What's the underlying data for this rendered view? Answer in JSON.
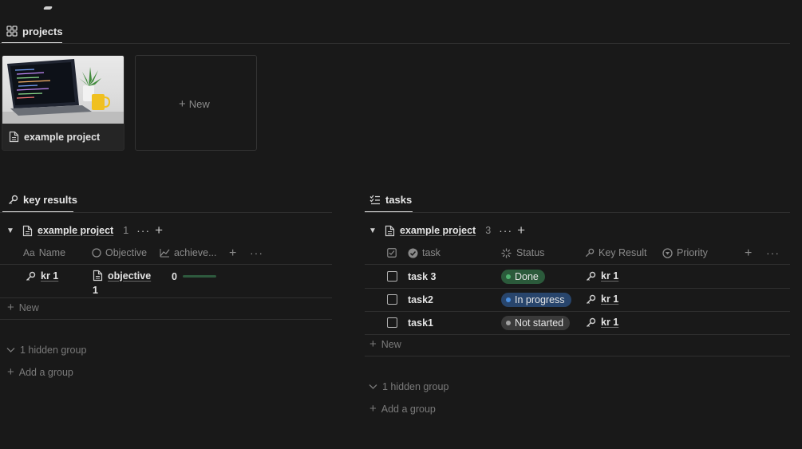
{
  "tabs": {
    "projects": "projects",
    "key_results": "key results",
    "tasks": "tasks"
  },
  "gallery": {
    "card_title": "example project",
    "new_label": "New"
  },
  "key_results": {
    "group_title": "example project",
    "group_count": "1",
    "columns": {
      "name": "Name",
      "objective": "Objective",
      "achievement": "achieve..."
    },
    "rows": [
      {
        "name": "kr 1",
        "objective_line1": "objective",
        "objective_line2": "1",
        "achievement": "0"
      }
    ],
    "new_label": "New",
    "hidden_group": "1 hidden group",
    "add_group": "Add a group"
  },
  "tasks": {
    "group_title": "example project",
    "group_count": "3",
    "columns": {
      "task": "task",
      "status": "Status",
      "key_result": "Key Result",
      "priority": "Priority"
    },
    "rows": [
      {
        "task": "task 3",
        "status": "Done",
        "key_result": "kr 1"
      },
      {
        "task": "task2",
        "status": "In progress",
        "key_result": "kr 1"
      },
      {
        "task": "task1",
        "status": "Not started",
        "key_result": "kr 1"
      }
    ],
    "new_label": "New",
    "hidden_group": "1 hidden group",
    "add_group": "Add a group"
  },
  "colors": {
    "done_bg": "#2b5a3b",
    "done_dot": "#4fb06f",
    "progress_bg": "#28456c",
    "progress_dot": "#4a8fe0",
    "notstarted_bg": "#3a3a3a",
    "notstarted_dot": "#a0a0a0"
  }
}
